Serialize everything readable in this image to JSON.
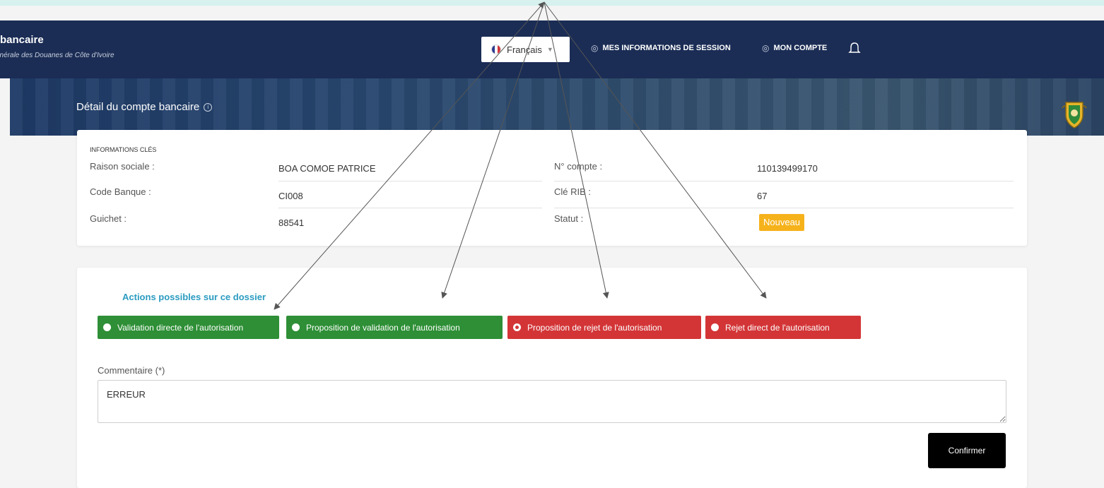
{
  "header": {
    "brand_title": "bancaire",
    "brand_subtitle": "énérale des Douanes de Côte d'Ivoire",
    "language": "Français",
    "session_link": "MES INFORMATIONS DE SESSION",
    "account_link": "MON COMPTE"
  },
  "hero": {
    "title": "Détail du compte bancaire"
  },
  "key_info": {
    "section_title": "INFORMATIONS CLÉS",
    "left": [
      {
        "label": "Raison sociale :",
        "value": "BOA COMOE PATRICE"
      },
      {
        "label": "Code Banque :",
        "value": "CI008"
      },
      {
        "label": "Guichet :",
        "value": "88541"
      }
    ],
    "right": [
      {
        "label": "N° compte :",
        "value": "110139499170"
      },
      {
        "label": "Clé RIB :",
        "value": "67"
      },
      {
        "label": "Statut :",
        "value": "Nouveau"
      }
    ]
  },
  "actions": {
    "title": "Actions possibles sur ce dossier",
    "options": [
      {
        "label": "Validation directe de l'autorisation",
        "color": "#2e8f36",
        "checked": false
      },
      {
        "label": "Proposition de validation de l'autorisation",
        "color": "#2e8f36",
        "checked": false
      },
      {
        "label": "Proposition de rejet de l'autorisation",
        "color": "#d33537",
        "checked": true
      },
      {
        "label": "Rejet direct de l'autorisation",
        "color": "#d33537",
        "checked": false
      }
    ],
    "comment_label": "Commentaire (*)",
    "comment_value": "ERREUR",
    "confirm_label": "Confirmer"
  },
  "colors": {
    "navbar": "#1b2d55",
    "status_badge": "#f6b21b",
    "actions_title": "#2b9bc0",
    "annotation_arrows": "#555555"
  }
}
